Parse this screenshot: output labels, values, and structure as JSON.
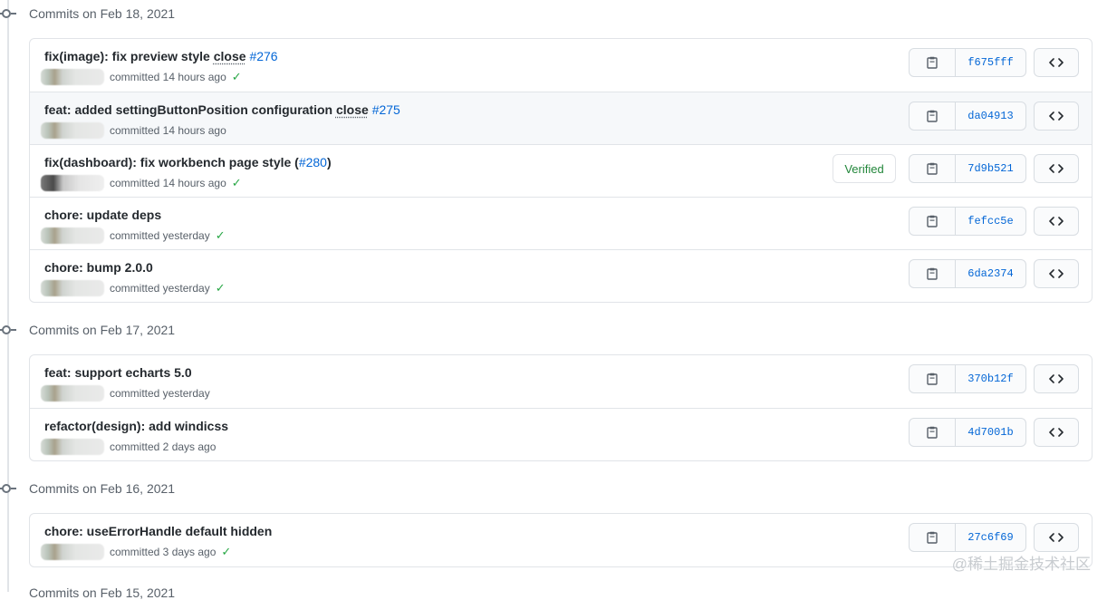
{
  "groups": [
    {
      "date_label": "Commits on Feb 18, 2021",
      "commits": [
        {
          "message": "fix(image): fix preview style ",
          "close_word": "close",
          "issue": "#276",
          "suffix": "",
          "time": "committed 14 hours ago",
          "check": true,
          "verified": false,
          "sha": "f675fff",
          "highlight": false
        },
        {
          "message": "feat: added settingButtonPosition configuration ",
          "close_word": "close",
          "issue": "#275",
          "suffix": "",
          "time": "committed 14 hours ago",
          "check": false,
          "verified": false,
          "sha": "da04913",
          "highlight": true
        },
        {
          "message": "fix(dashboard): fix workbench page style (",
          "close_word": "",
          "issue": "#280",
          "suffix": ")",
          "time": "committed 14 hours ago",
          "check": true,
          "verified": true,
          "sha": "7d9b521",
          "highlight": false
        },
        {
          "message": "chore: update deps",
          "close_word": "",
          "issue": "",
          "suffix": "",
          "time": "committed yesterday",
          "check": true,
          "verified": false,
          "sha": "fefcc5e",
          "highlight": false
        },
        {
          "message": "chore: bump 2.0.0",
          "close_word": "",
          "issue": "",
          "suffix": "",
          "time": "committed yesterday",
          "check": true,
          "verified": false,
          "sha": "6da2374",
          "highlight": false
        }
      ]
    },
    {
      "date_label": "Commits on Feb 17, 2021",
      "commits": [
        {
          "message": "feat: support echarts 5.0",
          "close_word": "",
          "issue": "",
          "suffix": "",
          "time": "committed yesterday",
          "check": false,
          "verified": false,
          "sha": "370b12f",
          "highlight": false
        },
        {
          "message": "refactor(design): add windicss",
          "close_word": "",
          "issue": "",
          "suffix": "",
          "time": "committed 2 days ago",
          "check": false,
          "verified": false,
          "sha": "4d7001b",
          "highlight": false
        }
      ]
    },
    {
      "date_label": "Commits on Feb 16, 2021",
      "commits": [
        {
          "message": "chore: useErrorHandle default hidden",
          "close_word": "",
          "issue": "",
          "suffix": "",
          "time": "committed 3 days ago",
          "check": true,
          "verified": false,
          "sha": "27c6f69",
          "highlight": false
        }
      ]
    }
  ],
  "verified_label": "Verified",
  "check_glyph": "✓",
  "icons": {
    "copy": "clipboard-icon",
    "browse": "code-icon"
  },
  "next_group_label": "Commits on Feb 15, 2021",
  "watermark": "@稀土掘金技术社区",
  "colors": {
    "link": "#0366d6",
    "verified": "#22863a",
    "check": "#28a745"
  }
}
